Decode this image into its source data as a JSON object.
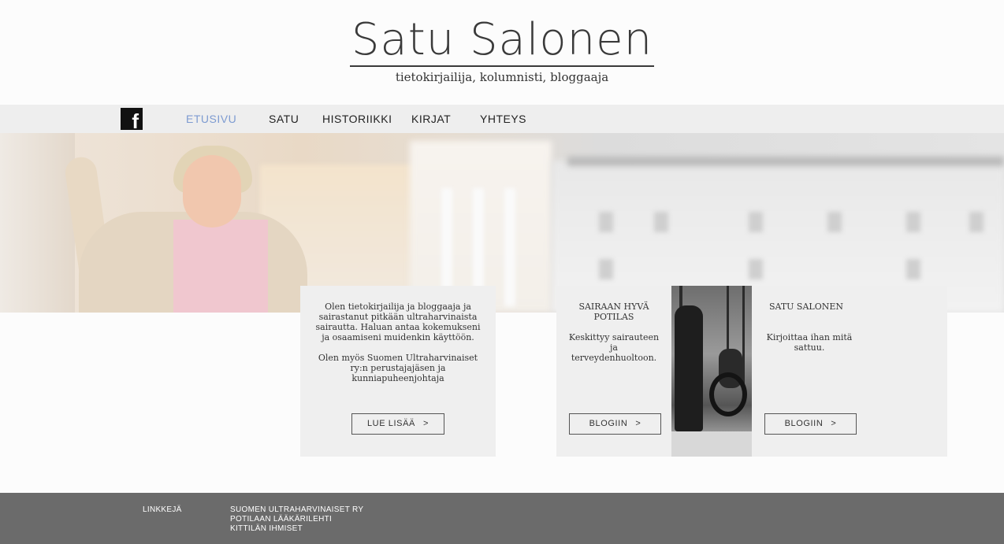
{
  "header": {
    "title": "Satu Salonen",
    "subtitle": "tietokirjailija, kolumnisti, bloggaaja"
  },
  "nav": {
    "facebook_icon": "facebook-icon",
    "items": [
      {
        "label": "ETUSIVU",
        "active": true
      },
      {
        "label": "SATU",
        "active": false
      },
      {
        "label": "HISTORIIKKI",
        "active": false
      },
      {
        "label": "KIRJAT",
        "active": false
      },
      {
        "label": "YHTEYS",
        "active": false
      }
    ],
    "active_color": "#7d9bd1"
  },
  "intro_card": {
    "paragraph1": "Olen tietokirjailija ja bloggaaja ja sairastanut pitkään ultraharvinaista sairautta. Haluan antaa kokemukseni ja osaamiseni muidenkin käyttöön.",
    "paragraph2": "Olen myös Suomen Ultraharvinaiset ry:n perustajajäsen ja kunniapuheenjohtaja",
    "button_label": "LUE LISÄÄ",
    "button_arrow": ">"
  },
  "blog_card_1": {
    "title": "SAIRAAN HYVÄ POTILAS",
    "text": "Keskittyy sairauteen ja terveydenhuoltoon.",
    "button_label": "BLOGIIN",
    "button_arrow": ">"
  },
  "blog_card_2": {
    "title": "SATU SALONEN",
    "text": "Kirjoittaa ihan mitä sattuu.",
    "button_label": "BLOGIIN",
    "button_arrow": ">"
  },
  "footer": {
    "label": "LINKKEJÄ",
    "links": [
      "SUOMEN ULTRAHARVINAISET RY",
      "POTILAAN LÄÄKÄRILEHTI",
      "KITTILÄN IHMISET"
    ],
    "background": "#6b6b6b"
  }
}
